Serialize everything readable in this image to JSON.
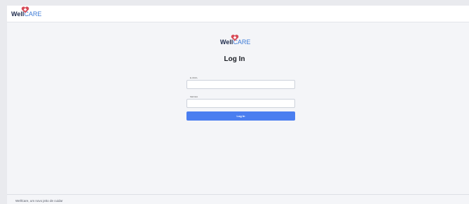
{
  "header": {
    "logo_text_left": "Well",
    "logo_text_right": "CARE"
  },
  "login": {
    "logo_text_left": "Well",
    "logo_text_right": "CARE",
    "title": "Log In",
    "email_label": "E-MAIL",
    "email_value": "",
    "password_label": "SENHA",
    "password_value": "",
    "submit_label": "Log In"
  },
  "footer": {
    "text": "WellCare, um novo jeito de cuidar"
  },
  "colors": {
    "accent": "#4a7ef0",
    "logo_heart": "#d84b57",
    "logo_blue": "#3d7bd6",
    "logo_navy": "#1f2c4d"
  },
  "icons": {
    "logo_mark": "heart-cross-icon"
  }
}
